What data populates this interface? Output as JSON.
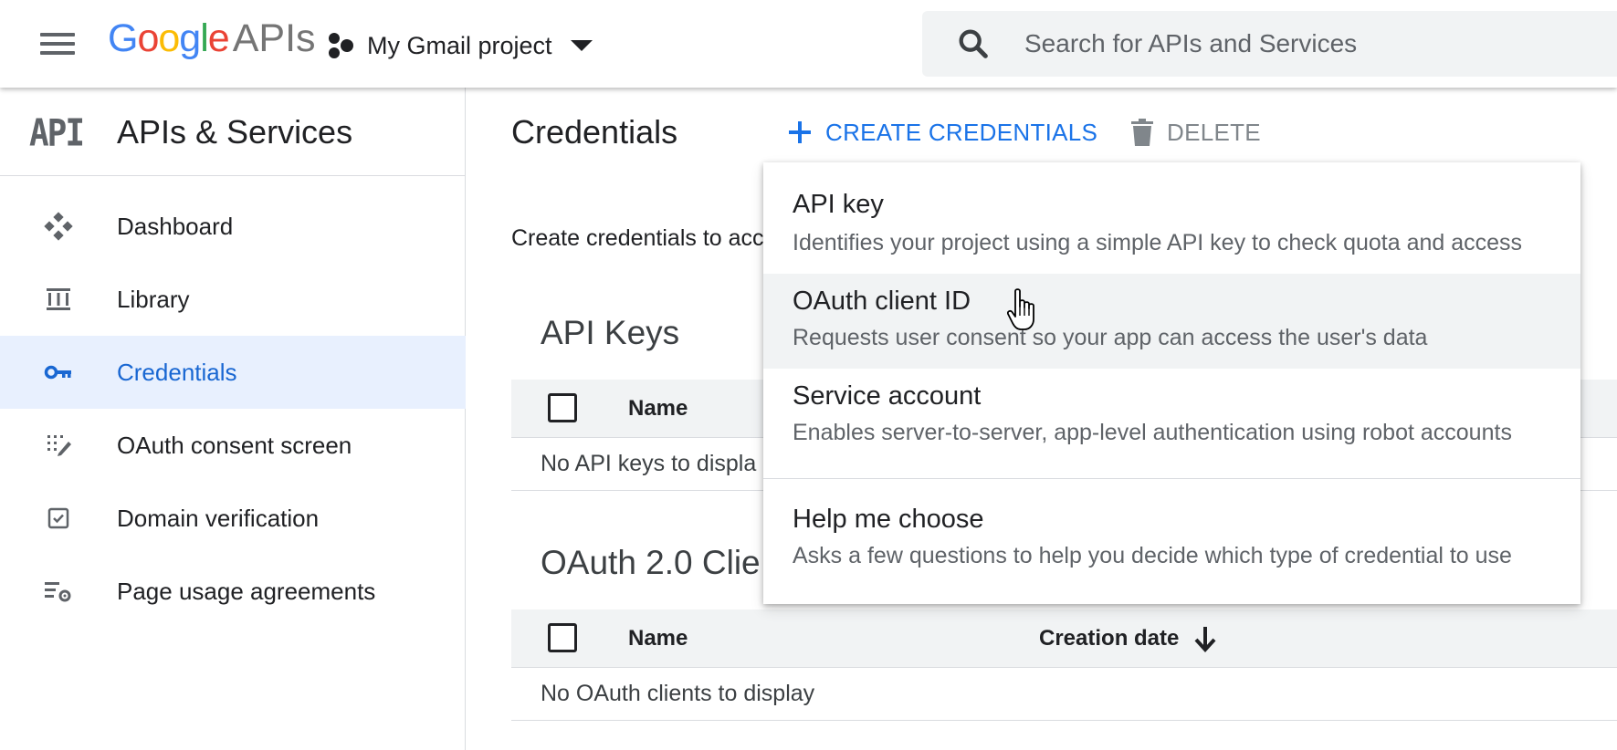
{
  "header": {
    "logo_google": [
      "G",
      "o",
      "o",
      "g",
      "l",
      "e"
    ],
    "logo_suffix": "APIs",
    "project_name": "My Gmail project",
    "search": {
      "placeholder": "Search for APIs and Services",
      "value": ""
    }
  },
  "sidebar": {
    "badge": "API",
    "title": "APIs & Services",
    "items": [
      {
        "label": "Dashboard",
        "icon": "dashboard-icon",
        "active": false
      },
      {
        "label": "Library",
        "icon": "library-icon",
        "active": false
      },
      {
        "label": "Credentials",
        "icon": "key-icon",
        "active": true
      },
      {
        "label": "OAuth consent screen",
        "icon": "consent-icon",
        "active": false
      },
      {
        "label": "Domain verification",
        "icon": "checkbox-icon",
        "active": false
      },
      {
        "label": "Page usage agreements",
        "icon": "settings-list-icon",
        "active": false
      }
    ]
  },
  "main": {
    "title": "Credentials",
    "create_label": "CREATE CREDENTIALS",
    "delete_label": "DELETE",
    "intro": "Create credentials to acc",
    "api_keys": {
      "title": "API Keys",
      "col_name": "Name",
      "empty": "No API keys to displa"
    },
    "oauth": {
      "title": "OAuth 2.0 Clie",
      "col_name": "Name",
      "col_date": "Creation date",
      "empty": "No OAuth clients to display"
    }
  },
  "menu": {
    "items": [
      {
        "title": "API key",
        "desc": "Identifies your project using a simple API key to check quota and access"
      },
      {
        "title": "OAuth client ID",
        "desc": "Requests user consent so your app can access the user's data",
        "hover": true
      },
      {
        "title": "Service account",
        "desc": "Enables server-to-server, app-level authentication using robot accounts"
      },
      {
        "title": "Help me choose",
        "desc": "Asks a few questions to help you decide which type of credential to use"
      }
    ]
  },
  "colors": {
    "accent": "#1a73e8",
    "active_bg": "#e8f0fe",
    "active_text": "#1967d2",
    "table_header_bg": "#f1f3f4"
  }
}
